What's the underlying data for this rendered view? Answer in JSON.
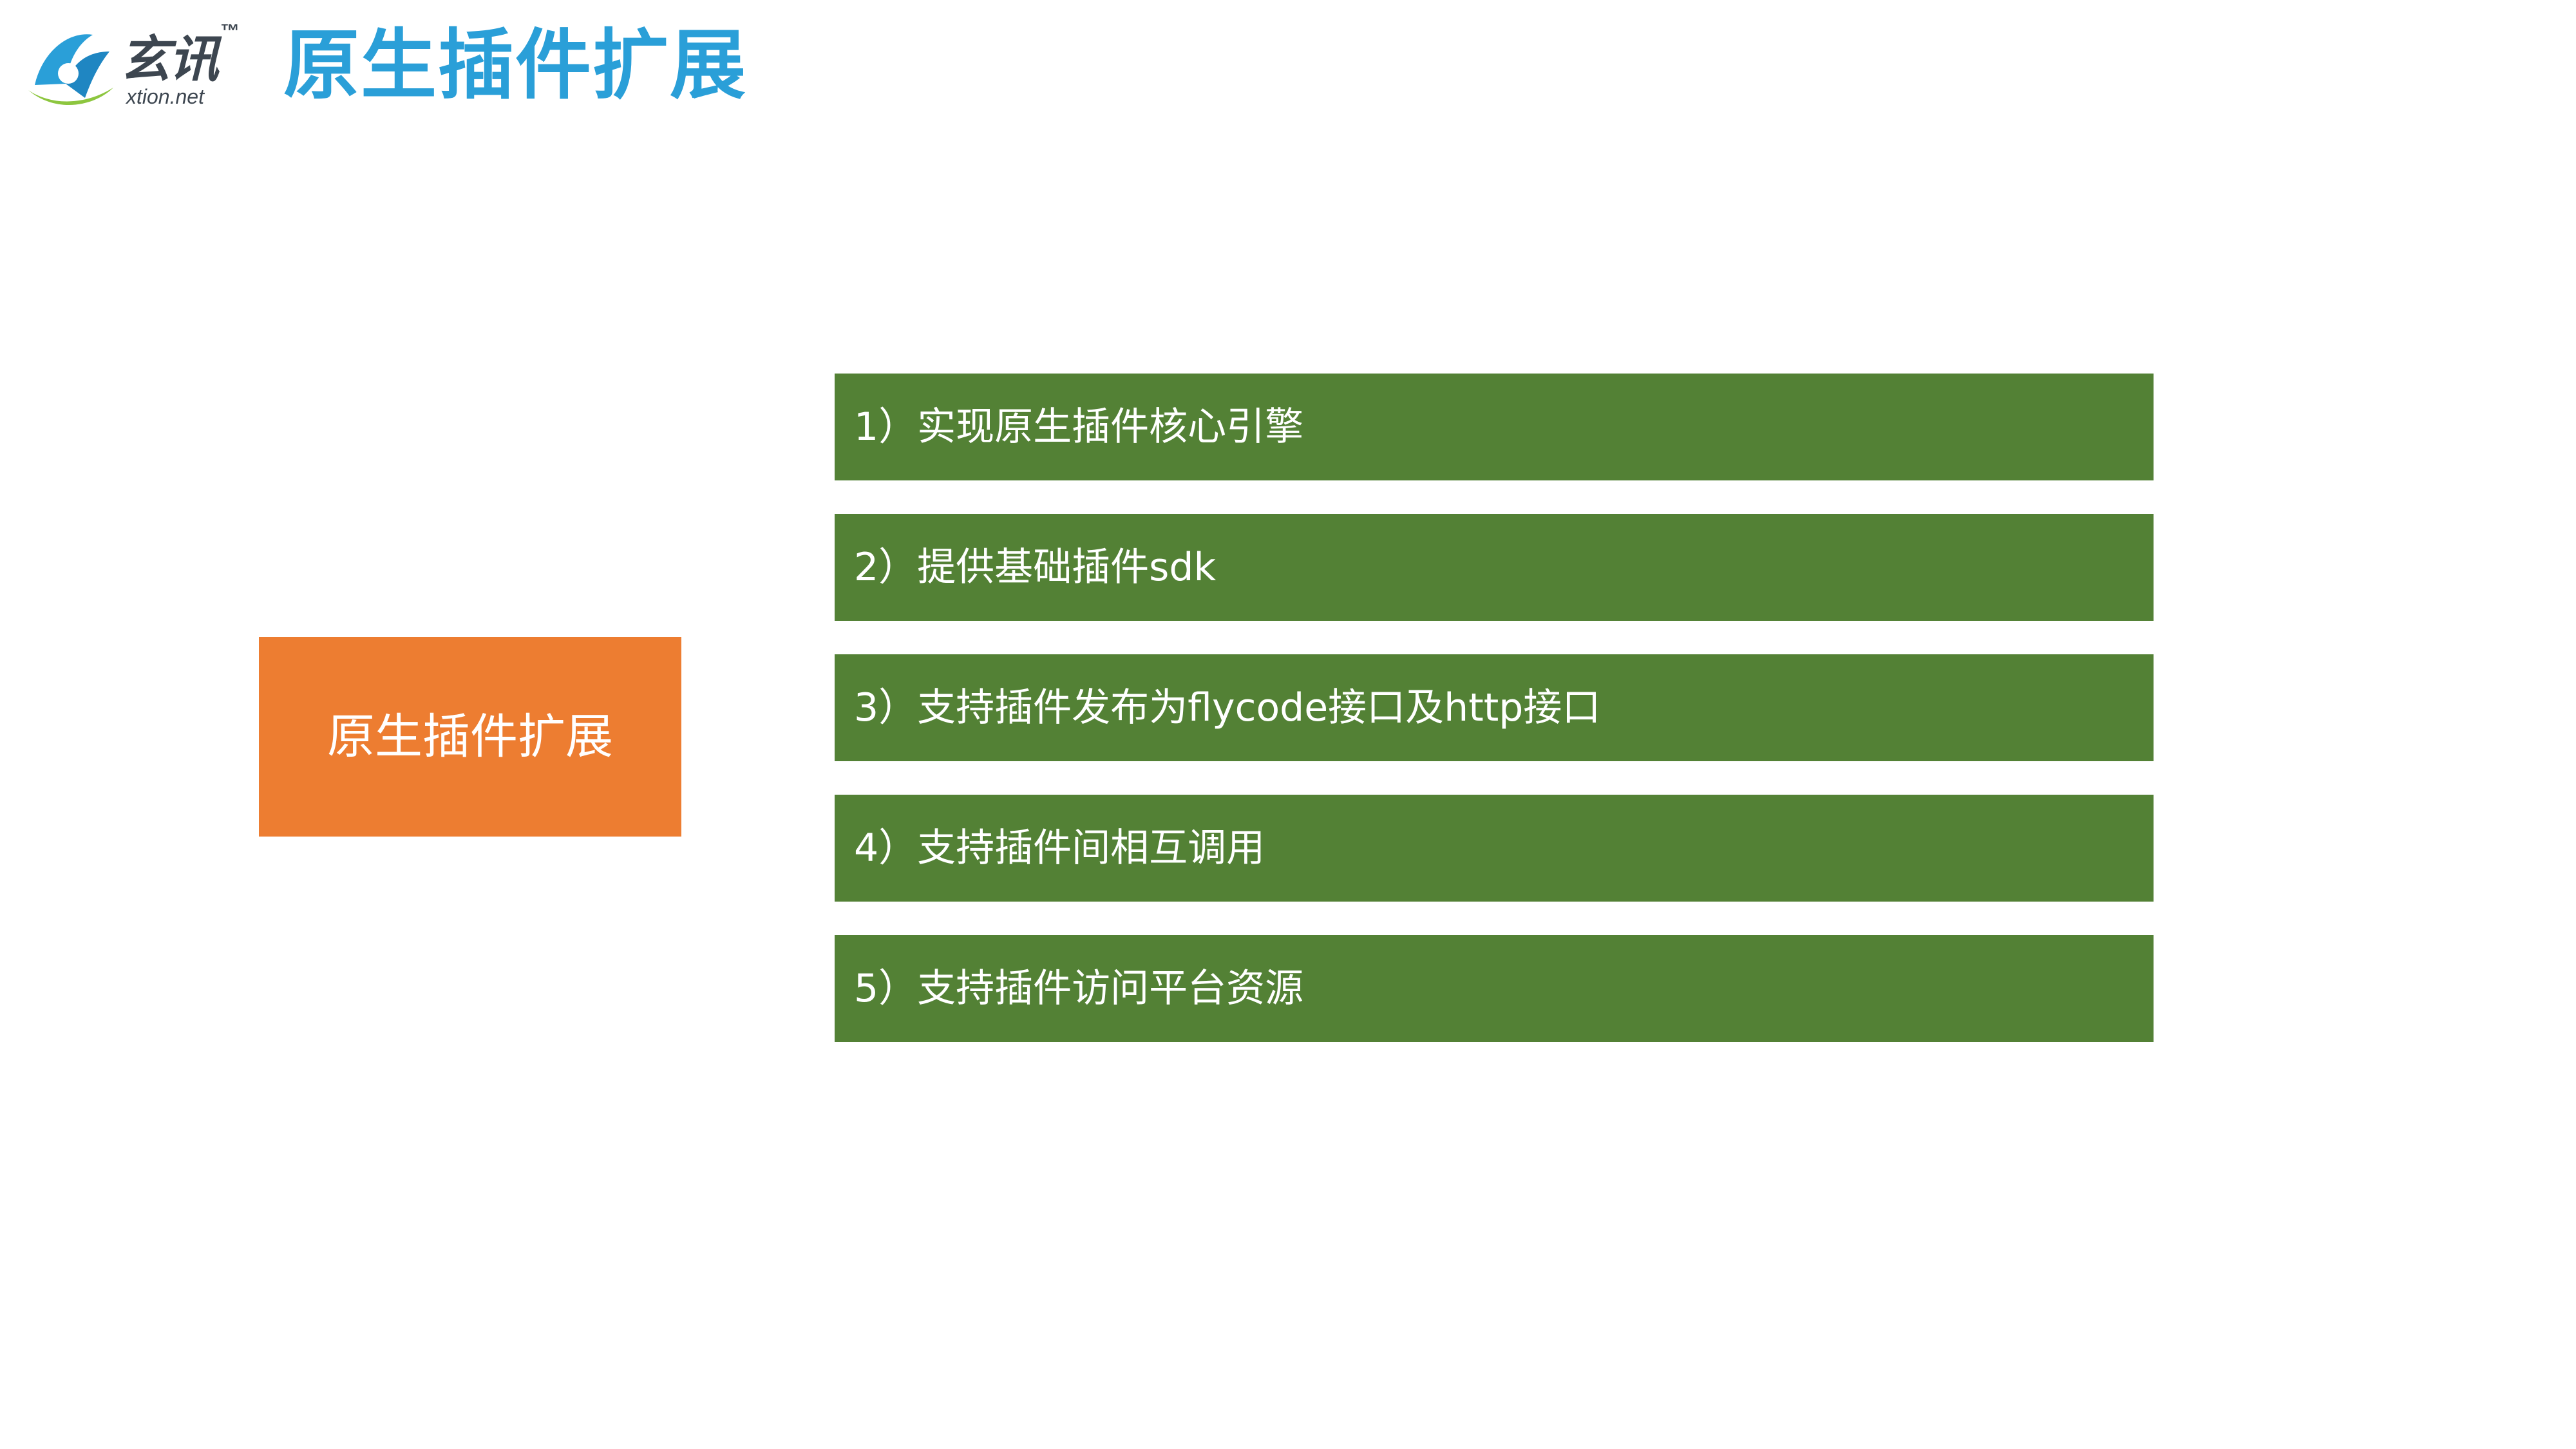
{
  "logo": {
    "cn_text": "玄讯",
    "tm": "™",
    "en_text": "xtion.net",
    "colors": {
      "blue": "#2a9fd8",
      "green": "#8dc63f",
      "dark": "#3d4650"
    }
  },
  "header": {
    "title": "原生插件扩展",
    "title_color": "#2a9fd8"
  },
  "main_box": {
    "label": "原生插件扩展",
    "color": "#ed7d31"
  },
  "items": [
    {
      "label": "1）实现原生插件核心引擎"
    },
    {
      "label": "2）提供基础插件sdk"
    },
    {
      "label": "3）支持插件发布为flycode接口及http接口"
    },
    {
      "label": "4）支持插件间相互调用"
    },
    {
      "label": "5）支持插件访问平台资源"
    }
  ],
  "item_color": "#538135"
}
